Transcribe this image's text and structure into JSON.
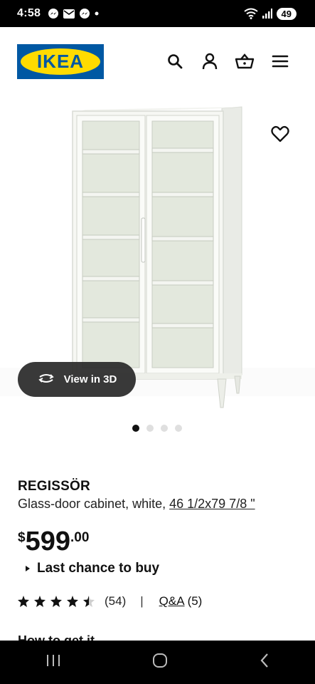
{
  "status_bar": {
    "time": "4:58",
    "battery": "49"
  },
  "header": {
    "logo_text": "IKEA",
    "icons": [
      "search-icon",
      "user-icon",
      "basket-icon",
      "menu-icon"
    ]
  },
  "gallery": {
    "view_3d_label": "View in 3D",
    "dot_count": 4,
    "active_index": 0
  },
  "product": {
    "name": "REGISSÖR",
    "description": "Glass-door cabinet, white, ",
    "measurement": "46 1/2x79 7/8 \"",
    "price": {
      "currency": "$",
      "integer": "599",
      "decimal": ".00"
    },
    "availability_note": "Last chance to buy",
    "rating": {
      "stars": 4.5,
      "reviews": "(54)",
      "separator": "|",
      "qa_label": "Q&A",
      "qa_count": "(5)"
    },
    "how_to_get": "How to get it"
  },
  "colors": {
    "ikea_blue": "#0058a3",
    "ikea_yellow": "#ffdb00"
  }
}
